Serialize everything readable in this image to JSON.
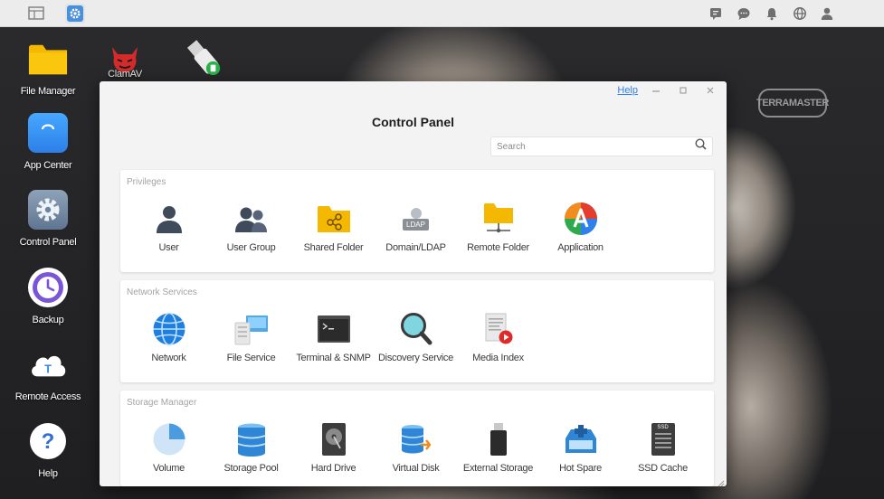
{
  "desktop": {
    "icons": [
      {
        "label": "File Manager",
        "icon": "folder-icon"
      },
      {
        "label": "App Center",
        "icon": "shopping-bag-icon"
      },
      {
        "label": "Control Panel",
        "icon": "gear-icon"
      },
      {
        "label": "Backup",
        "icon": "clock-icon"
      },
      {
        "label": "Remote Access",
        "icon": "cloud-icon"
      },
      {
        "label": "Help",
        "icon": "question-icon"
      }
    ],
    "top_apps": [
      {
        "label": "ClamAV",
        "icon": "clamav-devil-icon"
      },
      {
        "label": "",
        "icon": "usb-drive-icon"
      }
    ],
    "brand": "TERRAMASTER"
  },
  "window": {
    "title": "Control Panel",
    "help": "Help",
    "search_placeholder": "Search",
    "sections": [
      {
        "title": "Privileges",
        "items": [
          {
            "label": "User",
            "icon": "user-icon"
          },
          {
            "label": "User Group",
            "icon": "user-group-icon"
          },
          {
            "label": "Shared Folder",
            "icon": "shared-folder-icon"
          },
          {
            "label": "Domain/LDAP",
            "icon": "ldap-icon",
            "badge": "LDAP"
          },
          {
            "label": "Remote Folder",
            "icon": "remote-folder-icon"
          },
          {
            "label": "Application",
            "icon": "application-icon"
          }
        ]
      },
      {
        "title": "Network Services",
        "items": [
          {
            "label": "Network",
            "icon": "globe-icon"
          },
          {
            "label": "File Service",
            "icon": "file-service-icon"
          },
          {
            "label": "Terminal & SNMP",
            "icon": "terminal-icon"
          },
          {
            "label": "Discovery Service",
            "icon": "magnifier-icon"
          },
          {
            "label": "Media Index",
            "icon": "media-index-icon"
          }
        ]
      },
      {
        "title": "Storage Manager",
        "items": [
          {
            "label": "Volume",
            "icon": "pie-volume-icon"
          },
          {
            "label": "Storage Pool",
            "icon": "storage-pool-icon"
          },
          {
            "label": "Hard Drive",
            "icon": "hard-drive-icon"
          },
          {
            "label": "Virtual Disk",
            "icon": "virtual-disk-icon"
          },
          {
            "label": "External Storage",
            "icon": "external-storage-icon"
          },
          {
            "label": "Hot Spare",
            "icon": "hot-spare-icon"
          },
          {
            "label": "SSD Cache",
            "icon": "ssd-cache-icon",
            "badge": "SSD"
          }
        ]
      }
    ]
  },
  "colors": {
    "accent_blue": "#2f80ed",
    "folder_yellow": "#f5b800",
    "taskbar_bg": "#ececec",
    "window_bg": "#f3f3f3"
  }
}
